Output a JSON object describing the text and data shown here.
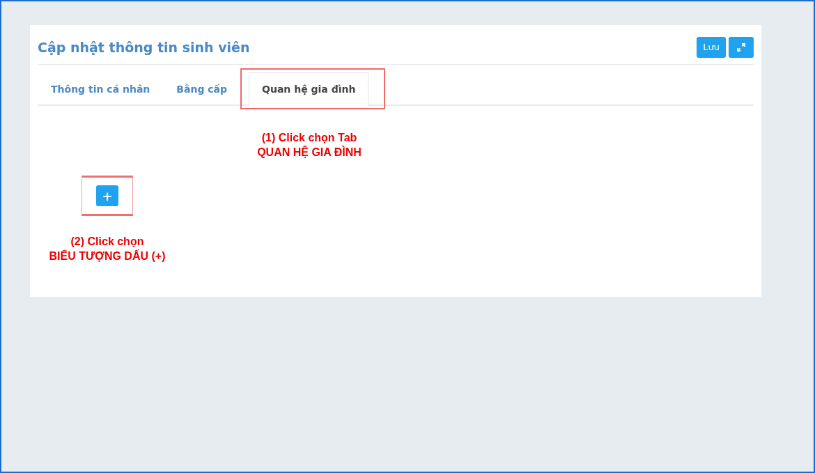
{
  "panel": {
    "title": "Cập nhật thông tin sinh viên",
    "buttons": [
      {
        "kind": "text",
        "label": "Lưu"
      },
      {
        "kind": "expand"
      }
    ]
  },
  "tabs": [
    {
      "label": "Thông tin cá nhân",
      "selected": false,
      "highlighted": false
    },
    {
      "label": "Bằng cấp",
      "selected": false,
      "highlighted": false
    },
    {
      "label": "Quan hệ gia đình",
      "selected": true,
      "highlighted": true
    }
  ],
  "add_button": {
    "label": "+",
    "highlighted": true
  },
  "annotations": [
    {
      "lines": [
        "(1) Click chọn Tab",
        "QUAN HỆ GIA ĐÌNH"
      ]
    },
    {
      "lines": [
        "(2) Click chọn",
        "BIỂU TƯỢNG DẤU (+)"
      ]
    }
  ]
}
